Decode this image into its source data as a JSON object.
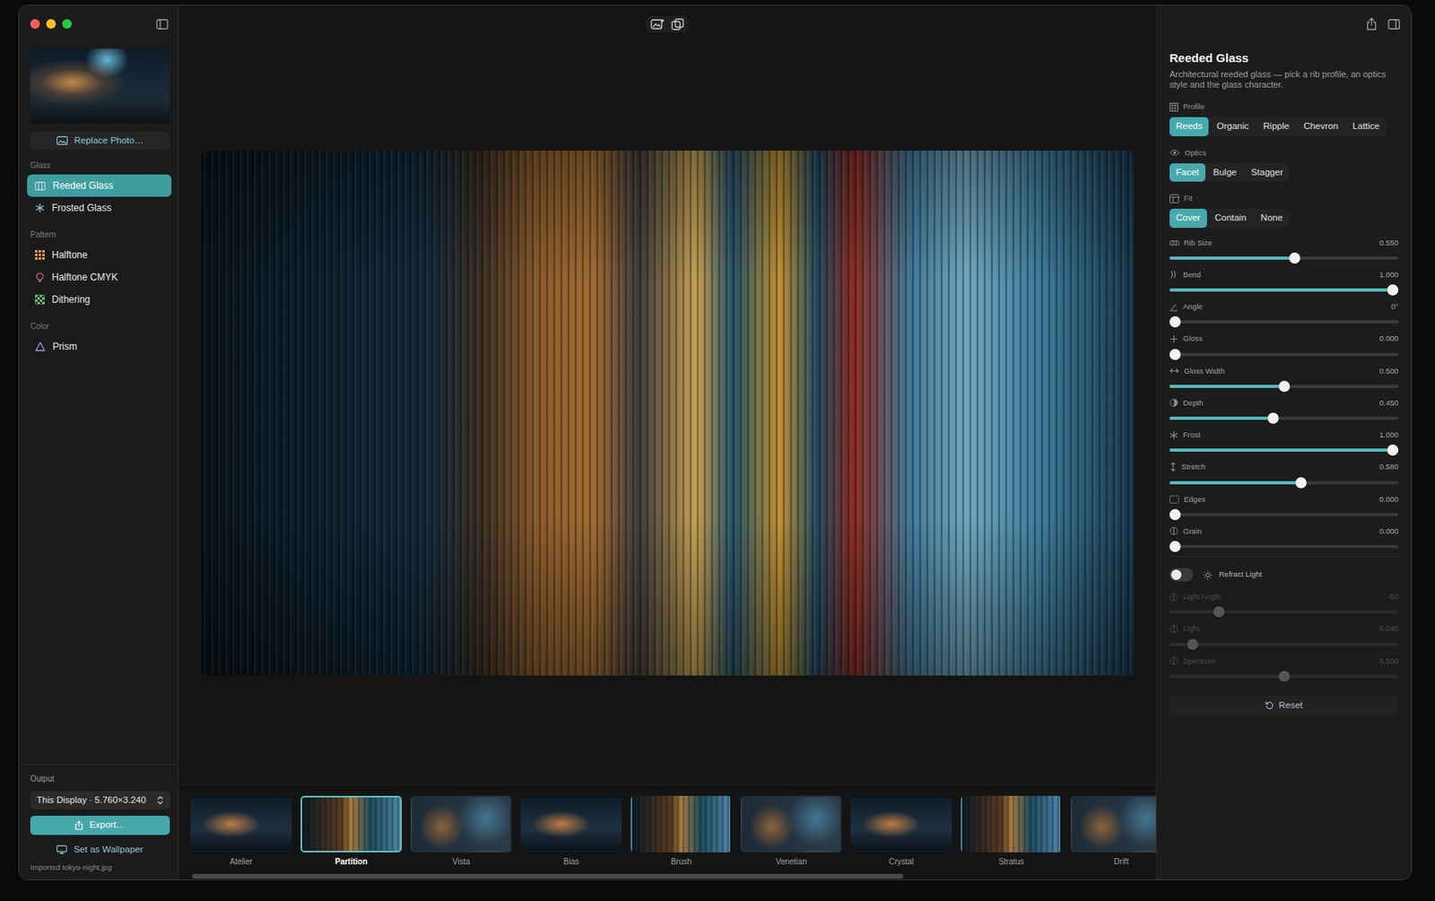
{
  "sidebar": {
    "replace_button": "Replace Photo…",
    "sections": [
      {
        "title": "Glass",
        "items": [
          {
            "label": "Reeded Glass",
            "selected": true
          },
          {
            "label": "Frosted Glass",
            "selected": false
          }
        ]
      },
      {
        "title": "Pattern",
        "items": [
          {
            "label": "Halftone",
            "selected": false
          },
          {
            "label": "Halftone CMYK",
            "selected": false
          },
          {
            "label": "Dithering",
            "selected": false
          }
        ]
      },
      {
        "title": "Color",
        "items": [
          {
            "label": "Prism",
            "selected": false
          }
        ]
      }
    ],
    "output": {
      "label": "Output",
      "display": "This Display · 5.760×3.240",
      "export": "Export…",
      "wallpaper": "Set as Wallpaper",
      "status": "Imported tokyo-night.jpg"
    }
  },
  "presets": {
    "items": [
      {
        "label": "Atelier",
        "selected": false
      },
      {
        "label": "Partition",
        "selected": true
      },
      {
        "label": "Vista",
        "selected": false
      },
      {
        "label": "Bias",
        "selected": false
      },
      {
        "label": "Brush",
        "selected": false
      },
      {
        "label": "Venetian",
        "selected": false
      },
      {
        "label": "Crystal",
        "selected": false
      },
      {
        "label": "Stratus",
        "selected": false
      },
      {
        "label": "Drift",
        "selected": false
      }
    ],
    "scrollbar": {
      "level": 0.85
    }
  },
  "inspector": {
    "title": "Reeded Glass",
    "description": "Architectural reeded glass — pick a rib profile, an optics style and the glass character.",
    "segments": [
      {
        "label": "Profile",
        "options": [
          {
            "label": "Reeds",
            "selected": true
          },
          {
            "label": "Organic",
            "selected": false
          },
          {
            "label": "Ripple",
            "selected": false
          },
          {
            "label": "Chevron",
            "selected": false
          },
          {
            "label": "Lattice",
            "selected": false
          }
        ]
      },
      {
        "label": "Optics",
        "options": [
          {
            "label": "Facet",
            "selected": true
          },
          {
            "label": "Bulge",
            "selected": false
          },
          {
            "label": "Stagger",
            "selected": false
          }
        ]
      },
      {
        "label": "Fit",
        "options": [
          {
            "label": "Cover",
            "selected": true
          },
          {
            "label": "Contain",
            "selected": false
          },
          {
            "label": "None",
            "selected": false
          }
        ]
      }
    ],
    "sliders": [
      {
        "label": "Rib Size",
        "reading": "0.550",
        "level": 0.55
      },
      {
        "label": "Bend",
        "reading": "1.000",
        "level": 1.0
      },
      {
        "label": "Angle",
        "reading": "0°",
        "level": 0.0
      },
      {
        "label": "Gloss",
        "reading": "0.000",
        "level": 0.0
      },
      {
        "label": "Gloss Width",
        "reading": "0.500",
        "level": 0.5
      },
      {
        "label": "Depth",
        "reading": "0.450",
        "level": 0.45
      },
      {
        "label": "Frost",
        "reading": "1.000",
        "level": 1.0
      },
      {
        "label": "Stretch",
        "reading": "0.580",
        "level": 0.58
      },
      {
        "label": "Edges",
        "reading": "0.000",
        "level": 0.0
      },
      {
        "label": "Grain",
        "reading": "0.000",
        "level": 0.0
      }
    ],
    "refract": {
      "label": "Refract Light",
      "on": false,
      "sliders": [
        {
          "label": "Light Angle",
          "reading": "-50",
          "level": 0.2,
          "disabled": true
        },
        {
          "label": "Light",
          "reading": "0.040",
          "level": 0.08,
          "disabled": true
        },
        {
          "label": "Spectrum",
          "reading": "0.500",
          "level": 0.5,
          "disabled": true
        }
      ]
    },
    "reset": "Reset"
  }
}
